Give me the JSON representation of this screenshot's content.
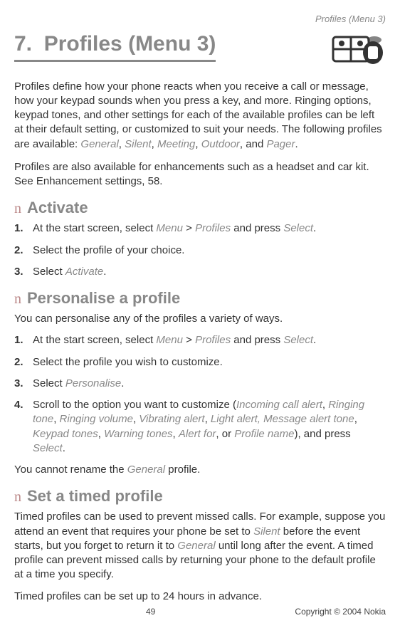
{
  "header": {
    "breadcrumb": "Profiles (Menu 3)"
  },
  "title": {
    "number": "7.",
    "text": "Profiles (Menu 3)"
  },
  "intro": {
    "p1_parts": [
      {
        "t": "Profiles define how your phone reacts when you receive a call or message, how your keypad sounds when you press a key, and more. Ringing options, keypad tones, and other settings for each of the available profiles can be left at their default setting, or customized to suit your needs. The following profiles are available: "
      },
      {
        "t": "General",
        "i": true
      },
      {
        "t": ", "
      },
      {
        "t": "Silent",
        "i": true
      },
      {
        "t": ", "
      },
      {
        "t": "Meeting",
        "i": true
      },
      {
        "t": ", "
      },
      {
        "t": "Outdoor",
        "i": true
      },
      {
        "t": ", and "
      },
      {
        "t": "Pager",
        "i": true
      },
      {
        "t": "."
      }
    ],
    "p2": "Profiles are also available for enhancements such as a headset and car kit.  See Enhancement settings, 58."
  },
  "activate": {
    "bullet": "n",
    "heading": "Activate",
    "steps": [
      [
        {
          "t": "At the start screen, select "
        },
        {
          "t": "Menu",
          "i": true
        },
        {
          "t": " > "
        },
        {
          "t": "Profiles",
          "i": true
        },
        {
          "t": " and press "
        },
        {
          "t": "Select",
          "i": true
        },
        {
          "t": "."
        }
      ],
      [
        {
          "t": "Select the profile of your choice."
        }
      ],
      [
        {
          "t": "Select "
        },
        {
          "t": "Activate",
          "i": true
        },
        {
          "t": "."
        }
      ]
    ]
  },
  "personalise": {
    "bullet": "n",
    "heading": "Personalise a profile",
    "intro": "You can personalise any of the profiles a variety of ways.",
    "steps": [
      [
        {
          "t": "At the start screen, select "
        },
        {
          "t": "Menu",
          "i": true
        },
        {
          "t": " > "
        },
        {
          "t": "Profiles",
          "i": true
        },
        {
          "t": " and press "
        },
        {
          "t": "Select",
          "i": true
        },
        {
          "t": "."
        }
      ],
      [
        {
          "t": "Select the profile you wish to customize."
        }
      ],
      [
        {
          "t": "Select "
        },
        {
          "t": "Personalise",
          "i": true
        },
        {
          "t": "."
        }
      ],
      [
        {
          "t": "Scroll to the option you want to customize ("
        },
        {
          "t": "Incoming call alert",
          "i": true
        },
        {
          "t": ", "
        },
        {
          "t": "Ringing tone",
          "i": true
        },
        {
          "t": ", "
        },
        {
          "t": "Ringing volume",
          "i": true
        },
        {
          "t": ", "
        },
        {
          "t": "Vibrating alert",
          "i": true
        },
        {
          "t": ", "
        },
        {
          "t": "Light alert, Message alert tone",
          "i": true
        },
        {
          "t": ", "
        },
        {
          "t": "Keypad tones",
          "i": true
        },
        {
          "t": ", "
        },
        {
          "t": "Warning tones",
          "i": true
        },
        {
          "t": ", "
        },
        {
          "t": "Alert for",
          "i": true
        },
        {
          "t": ", or "
        },
        {
          "t": "Profile name",
          "i": true
        },
        {
          "t": "), and press "
        },
        {
          "t": "Select",
          "i": true
        },
        {
          "t": "."
        }
      ]
    ],
    "note_parts": [
      {
        "t": "You cannot rename the "
      },
      {
        "t": "General",
        "i": true
      },
      {
        "t": " profile."
      }
    ]
  },
  "timed": {
    "bullet": "n",
    "heading": "Set a timed profile",
    "p1_parts": [
      {
        "t": "Timed profiles can be used to prevent missed calls. For example, suppose you attend an event that requires your phone be set to "
      },
      {
        "t": "Silent",
        "i": true
      },
      {
        "t": " before the event starts, but you forget to return it to "
      },
      {
        "t": "General",
        "i": true
      },
      {
        "t": " until long after the event. A timed profile can prevent missed calls by returning your phone to the default profile at a time you specify."
      }
    ],
    "p2": "Timed profiles can be set up to 24 hours in advance."
  },
  "footer": {
    "page": "49",
    "copyright": "Copyright © 2004 Nokia"
  }
}
